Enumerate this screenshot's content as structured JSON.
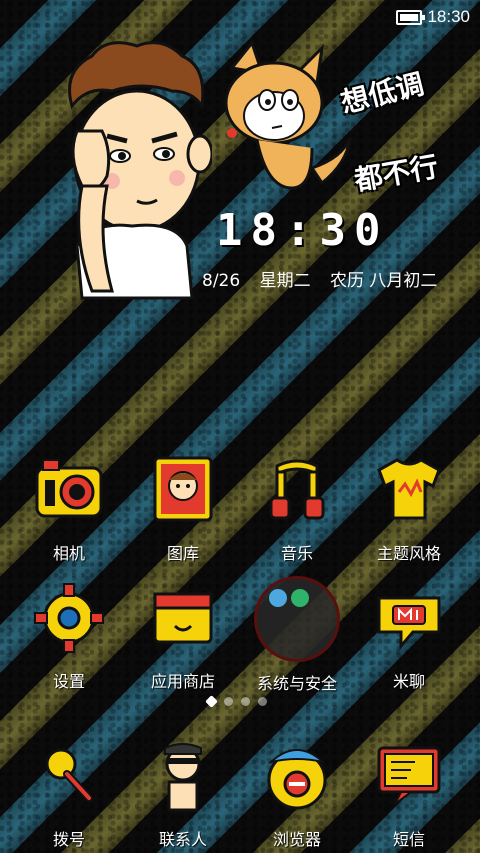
{
  "status": {
    "time": "18:30"
  },
  "slogan": {
    "line1": "想低调",
    "line2": "都不行"
  },
  "clock": {
    "time": "18:30",
    "date": "8/26",
    "weekday": "星期二",
    "lunar": "农历 八月初二"
  },
  "apps": [
    {
      "label": "相机",
      "icon": "camera-icon"
    },
    {
      "label": "图库",
      "icon": "gallery-icon"
    },
    {
      "label": "音乐",
      "icon": "music-icon"
    },
    {
      "label": "主题风格",
      "icon": "theme-icon"
    },
    {
      "label": "设置",
      "icon": "settings-icon"
    },
    {
      "label": "应用商店",
      "icon": "app-store-icon"
    },
    {
      "label": "系统与安全",
      "icon": "folder-icon"
    },
    {
      "label": "米聊",
      "icon": "miliao-icon"
    }
  ],
  "pager": {
    "pages": 4,
    "active": 1
  },
  "dock": [
    {
      "label": "拨号",
      "icon": "phone-icon"
    },
    {
      "label": "联系人",
      "icon": "contacts-icon"
    },
    {
      "label": "浏览器",
      "icon": "browser-icon"
    },
    {
      "label": "短信",
      "icon": "messages-icon"
    }
  ],
  "colors": {
    "accent_yellow": "#f5d20a",
    "accent_red": "#e23b2e",
    "outline": "#111111"
  }
}
